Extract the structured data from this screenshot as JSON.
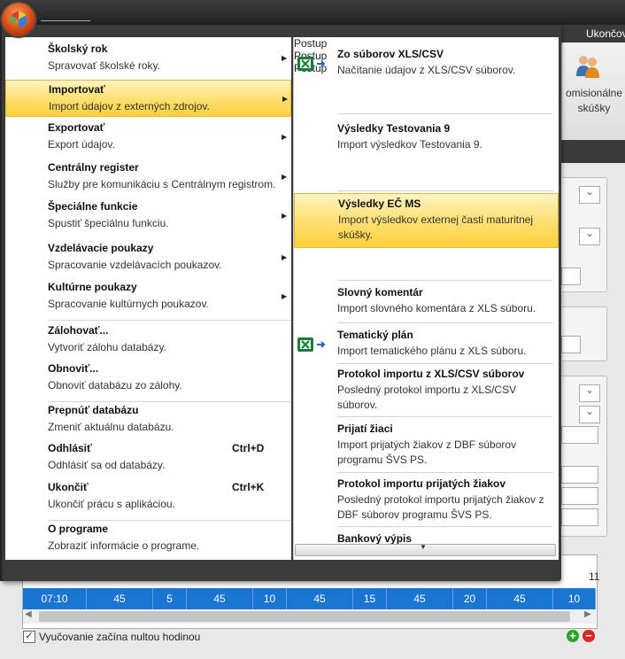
{
  "window": {
    "ribbon_tab_label": "Ukončov",
    "ribbon_button_label": "omisionálne skúšky"
  },
  "menu_left": {
    "items": [
      {
        "title": "Školský rok",
        "desc": "Spravovať školské roky.",
        "submenu": true
      },
      {
        "title": "Importovať",
        "desc": "Import údajov z externých zdrojov.",
        "submenu": true,
        "highlighted": true
      },
      {
        "title": "Exportovať",
        "desc": "Export údajov.",
        "submenu": true
      },
      {
        "title": "Centrálny register",
        "desc": "Služby pre komunikáciu s Centrálnym registrom.",
        "submenu": true
      },
      {
        "title": "Špeciálne funkcie",
        "desc": "Spustiť špeciálnu funkciu.",
        "submenu": true
      },
      {
        "title": "Vzdelávacie poukazy",
        "desc": "Spracovanie vzdelávacích poukazov.",
        "submenu": true
      },
      {
        "title": "Kultúrne poukazy",
        "desc": "Spracovanie kultúrnych poukazov.",
        "submenu": true
      },
      {
        "title": "Zálohovať...",
        "desc": "Vytvoriť zálohu databázy."
      },
      {
        "title": "Obnoviť...",
        "desc": "Obnoviť databázu zo zálohy."
      },
      {
        "title": "Prepnúť databázu",
        "desc": "Zmeniť aktuálnu databázu."
      },
      {
        "title": "Odhlásiť",
        "desc": "Odhlásiť sa od databázy.",
        "shortcut": "Ctrl+D"
      },
      {
        "title": "Ukončiť",
        "desc": "Ukončiť prácu s aplikáciou.",
        "shortcut": "Ctrl+K"
      },
      {
        "title": "O programe",
        "desc": "Zobraziť informácie o programe."
      }
    ]
  },
  "menu_right": {
    "items": [
      {
        "title": "Zo súborov XLS/CSV",
        "desc": "Načítanie údajov z XLS/CSV súborov.",
        "link": "Postup",
        "icon": "excel-import-icon"
      },
      {
        "title": "Výsledky Testovania 9",
        "desc": "Import výsledkov Testovania 9.",
        "link": "Postup"
      },
      {
        "title": "Výsledky EČ MS",
        "desc": "Import výsledkov externej časti maturitnej skúšky.",
        "link": "Postup",
        "highlighted": true
      },
      {
        "title": "Slovný komentár",
        "desc": "Import slovného komentára z XLS súboru."
      },
      {
        "title": "Tematický plán",
        "desc": "Import tematického plánu z XLS súboru.",
        "icon": "excel-import-icon"
      },
      {
        "title": "Protokol importu z XLS/CSV súborov",
        "desc": "Posledný protokol importu z XLS/CSV súborov."
      },
      {
        "title": "Prijatí žiaci",
        "desc": "Import prijatých žiakov z DBF súborov programu ŠVS PS."
      },
      {
        "title": "Protokol importu prijatých žiakov",
        "desc": "Posledný protokol importu prijatých žiakov z DBF súborov programu ŠVS PS."
      },
      {
        "title": "Bankový výpis",
        "desc": ""
      }
    ]
  },
  "timetable": {
    "times": [
      "07:10",
      "45",
      "5",
      "45",
      "10",
      "45",
      "15",
      "45",
      "20",
      "45",
      "10"
    ],
    "partial_header": "11",
    "zero_hour_checkbox_label": "Vyučovanie začína nultou hodinou",
    "zero_hour_checked": true
  },
  "colors": {
    "highlight": "#ffd03a",
    "timeline": "#1a75d2",
    "link": "#1c3fbf"
  }
}
